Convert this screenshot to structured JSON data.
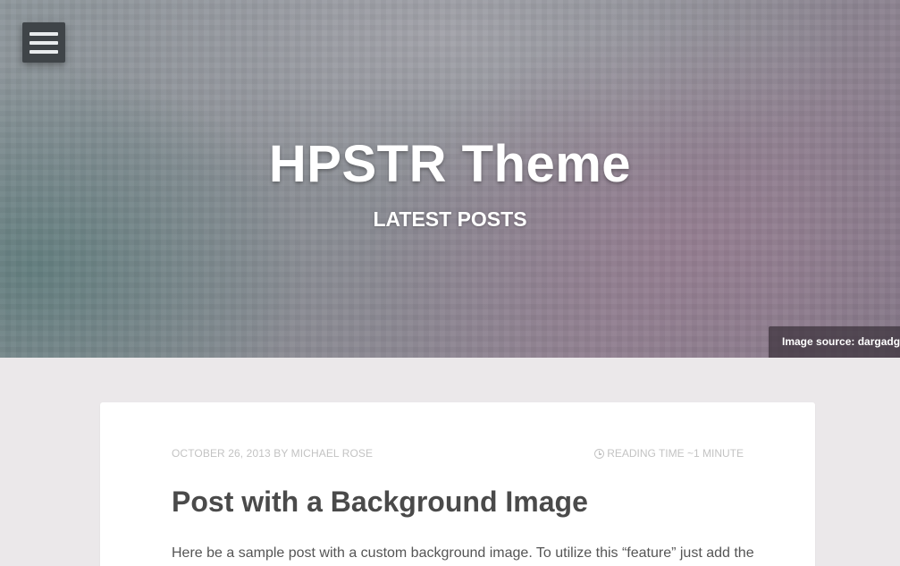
{
  "header": {
    "menu_icon": "hamburger-menu-icon",
    "site_title": "HPSTR Theme",
    "subtitle": "LATEST POSTS",
    "image_source": "Image source: dargadgetz"
  },
  "post": {
    "date": "OCTOBER 26, 2013",
    "by": "BY",
    "author": "MICHAEL ROSE",
    "reading_time": "READING TIME ~1 MINUTE",
    "reading_icon": "clock-icon",
    "title": "Post with a Background Image",
    "excerpt": "Here be a sample post with a custom background image. To utilize this “feature” just add the"
  },
  "colors": {
    "page_background": "#ebe8ea",
    "card_background": "#ffffff",
    "menu_button": "#3f4448",
    "meta_text": "#c3c3c3",
    "title_text": "#4a4a4a"
  }
}
